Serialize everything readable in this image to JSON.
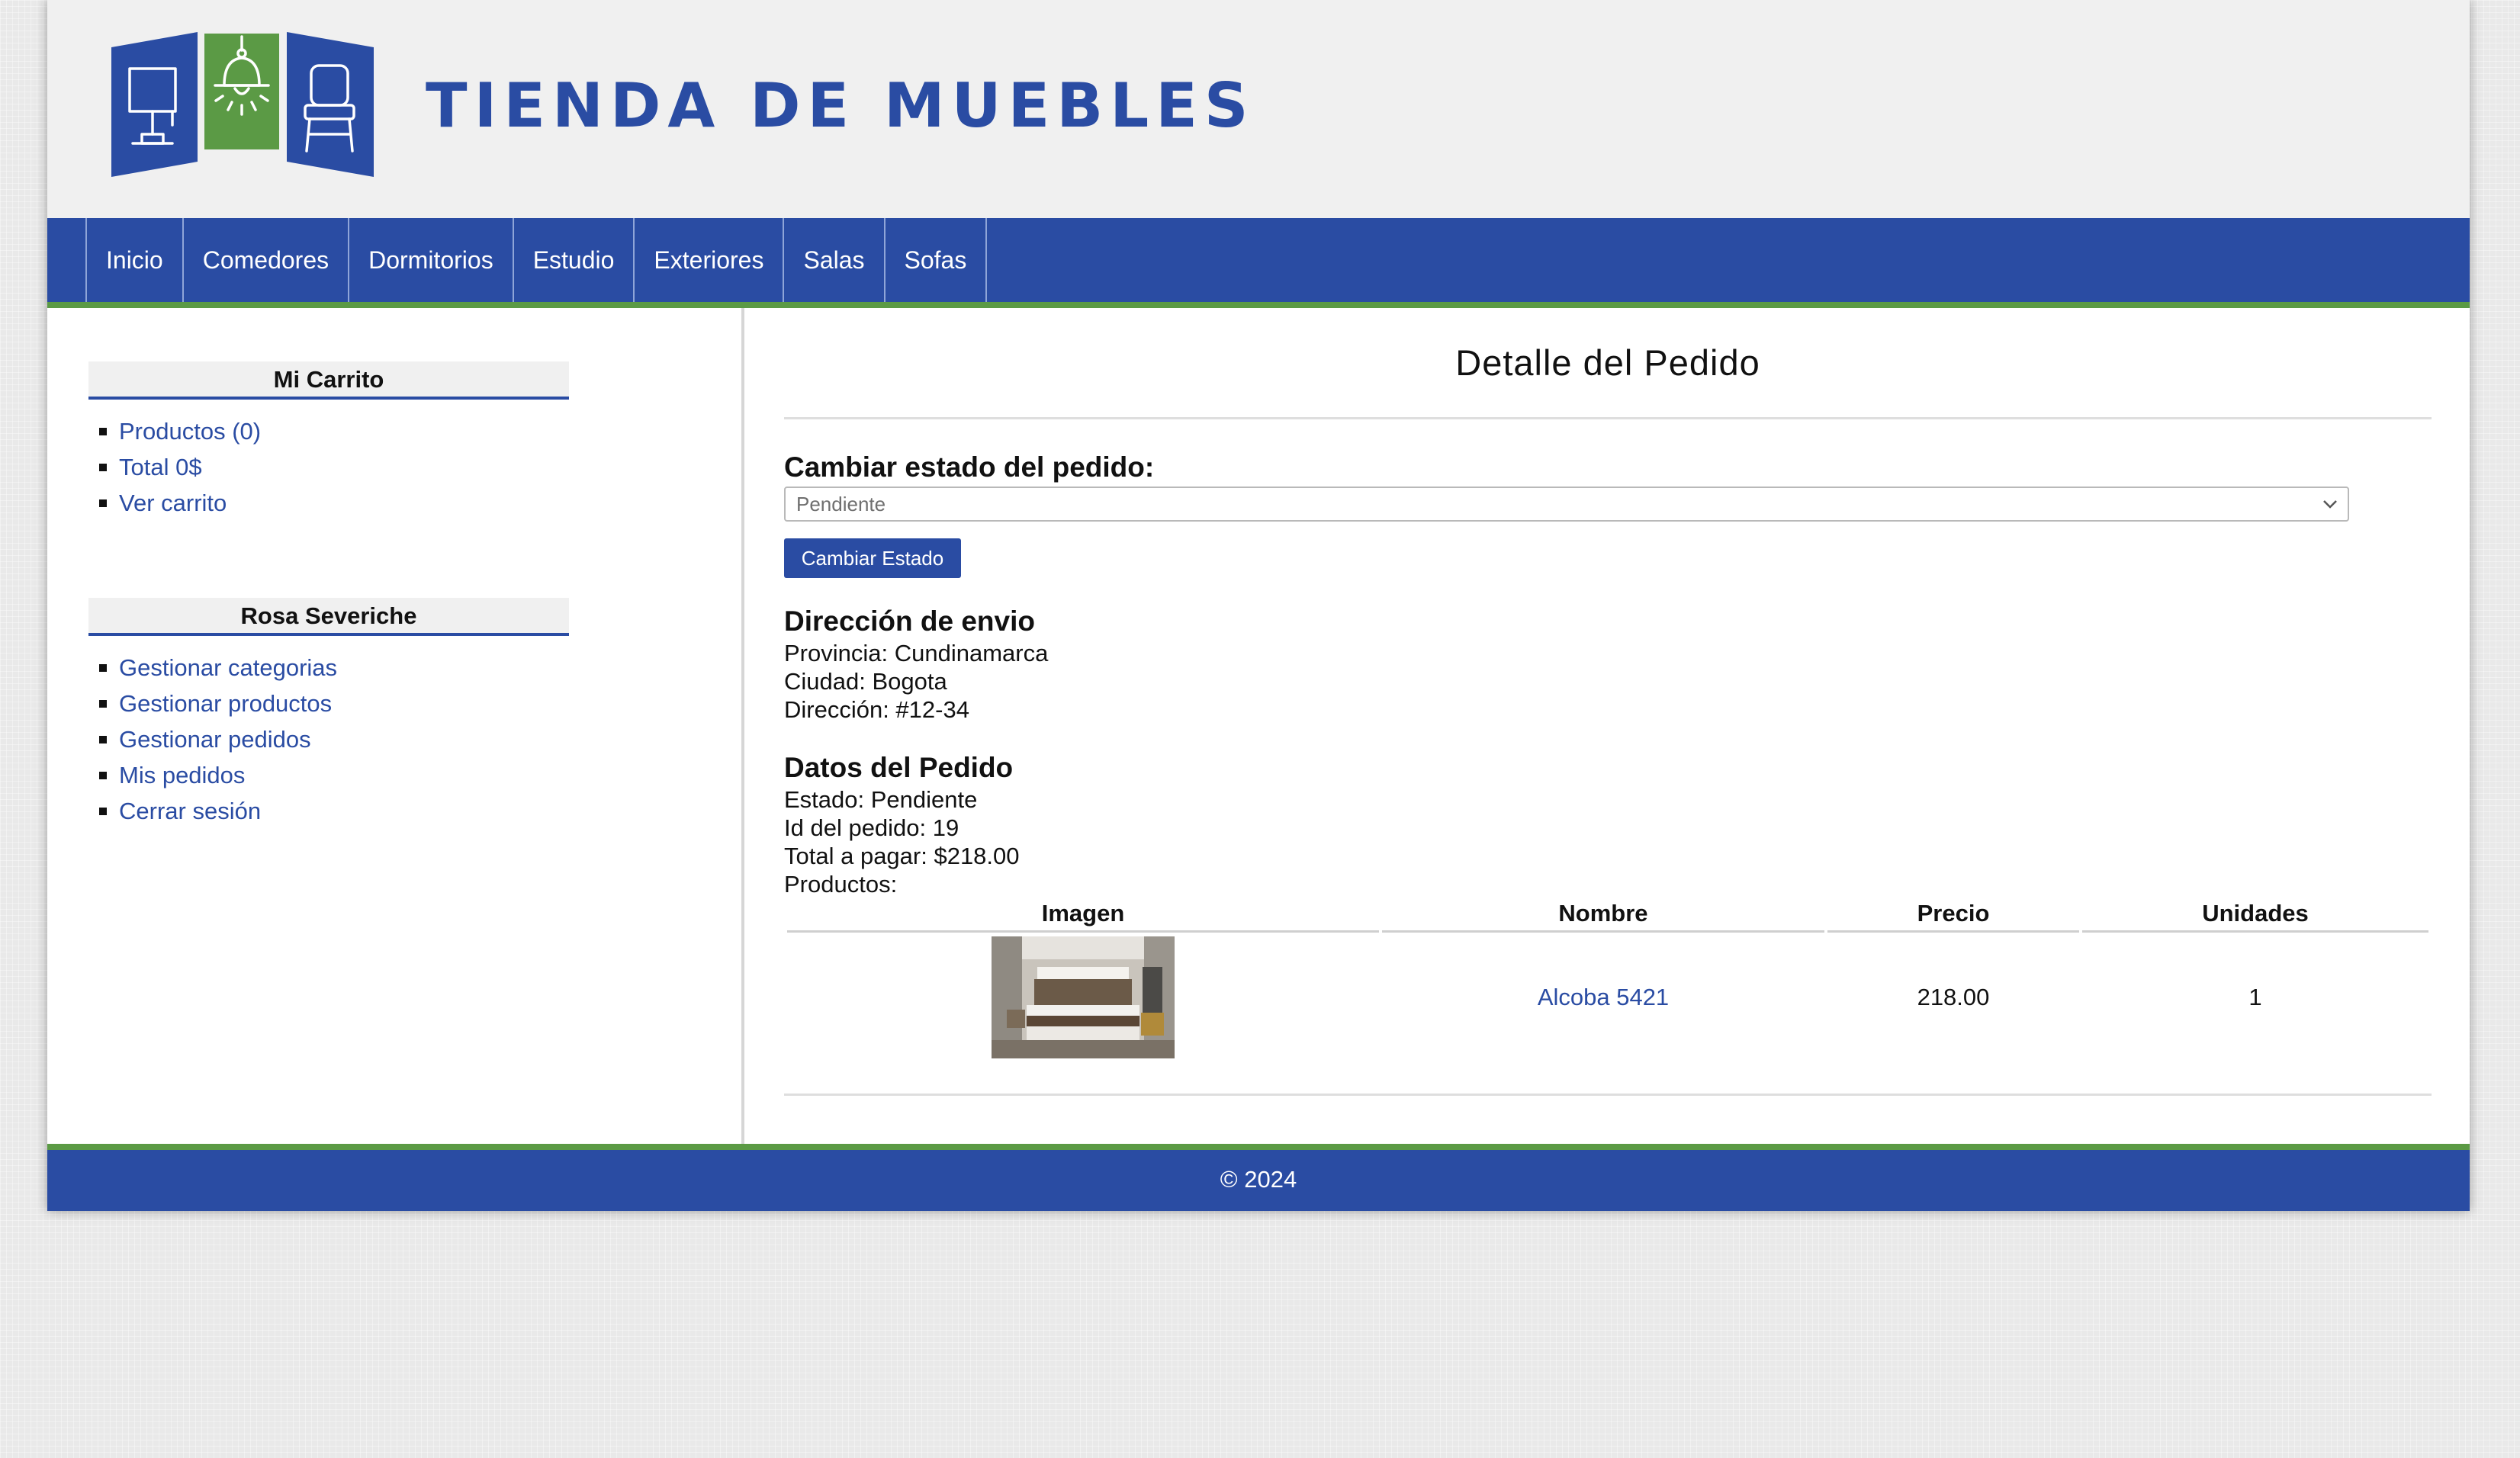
{
  "header": {
    "site_title": "TIENDA DE MUEBLES",
    "brand_blue": "#2a4ca3",
    "brand_green": "#5b9a45"
  },
  "nav": {
    "items": [
      {
        "label": "Inicio"
      },
      {
        "label": "Comedores"
      },
      {
        "label": "Dormitorios"
      },
      {
        "label": "Estudio"
      },
      {
        "label": "Exteriores"
      },
      {
        "label": "Salas"
      },
      {
        "label": "Sofas"
      }
    ]
  },
  "sidebar": {
    "cart": {
      "title": "Mi Carrito",
      "items": [
        {
          "label": "Productos (0)"
        },
        {
          "label": "Total 0$"
        },
        {
          "label": "Ver carrito"
        }
      ]
    },
    "user": {
      "title": "Rosa Severiche",
      "items": [
        {
          "label": "Gestionar categorias"
        },
        {
          "label": "Gestionar productos"
        },
        {
          "label": "Gestionar pedidos"
        },
        {
          "label": "Mis pedidos"
        },
        {
          "label": "Cerrar sesión"
        }
      ]
    }
  },
  "main": {
    "heading": "Detalle del Pedido",
    "status_form": {
      "label": "Cambiar estado del pedido:",
      "selected_value": "Pendiente",
      "button_label": "Cambiar Estado"
    },
    "shipping": {
      "title": "Dirección de envio",
      "lines": [
        "Provincia: Cundinamarca",
        "Ciudad: Bogota",
        "Dirección: #12-34"
      ]
    },
    "order": {
      "title": "Datos del Pedido",
      "lines": [
        "Estado: Pendiente",
        "Id del pedido: 19",
        "Total a pagar: $218.00",
        "Productos:"
      ]
    },
    "products_table": {
      "headers": {
        "image": "Imagen",
        "name": "Nombre",
        "price": "Precio",
        "units": "Unidades"
      },
      "rows": [
        {
          "name": "Alcoba 5421",
          "price": "218.00",
          "units": "1"
        }
      ]
    }
  },
  "footer": {
    "copyright": "© 2024"
  }
}
